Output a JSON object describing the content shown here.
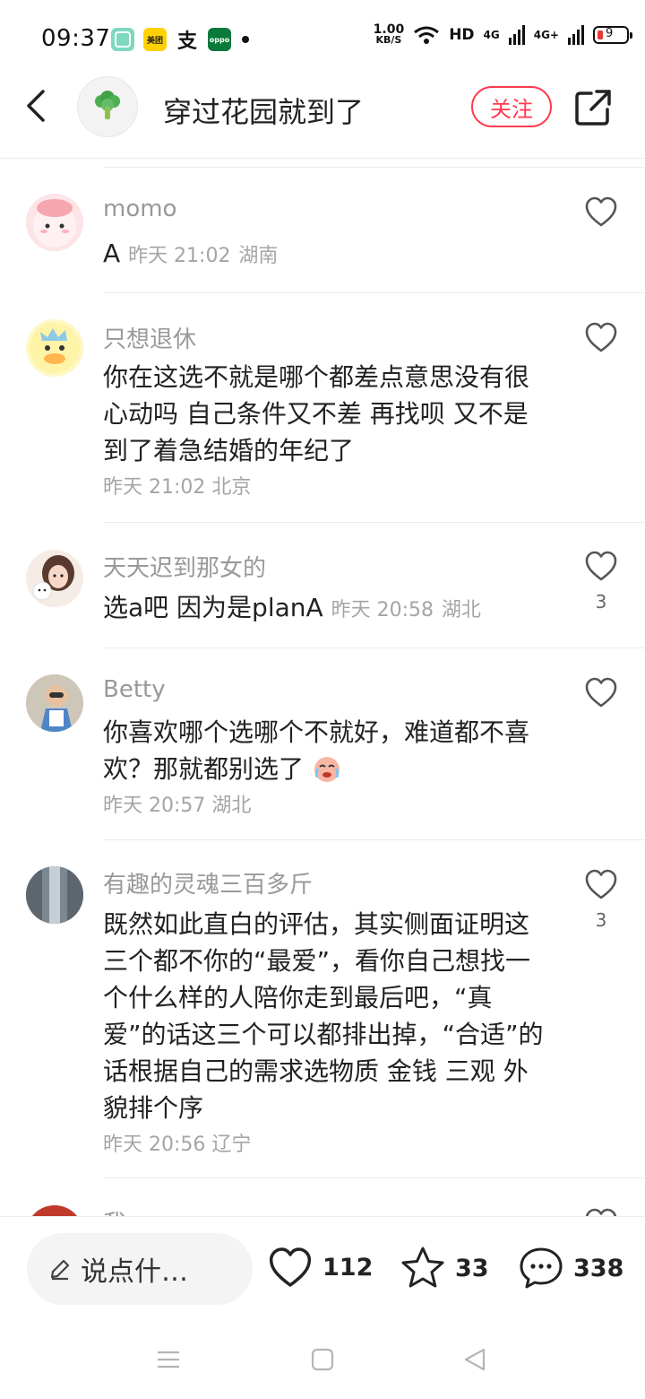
{
  "status_bar": {
    "time": "09:37",
    "net_speed_value": "1.00",
    "net_speed_unit": "KB/S",
    "hd_label": "HD",
    "signal1_label": "4G",
    "signal2_label": "4G+",
    "battery_level": "9",
    "app_icons": [
      "green-app-icon",
      "meituan-icon",
      "alipay-icon",
      "oppo-icon"
    ],
    "meituan_label": "美团",
    "alipay_label": "支",
    "oppo_label": "oppo"
  },
  "header": {
    "title": "穿过花园就到了",
    "follow_label": "关注"
  },
  "comments": [
    {
      "name": "momo",
      "text": "A",
      "time": "昨天 21:02",
      "location": "湖南",
      "likes": ""
    },
    {
      "name": "只想退休",
      "text": "你在这选不就是哪个都差点意思没有很心动吗 自己条件又不差 再找呗 又不是到了着急结婚的年纪了",
      "time": "昨天 21:02",
      "location": "北京",
      "likes": ""
    },
    {
      "name": "天天迟到那女的",
      "text": "选a吧 因为是planA",
      "time": "昨天 20:58",
      "location": "湖北",
      "likes": "3"
    },
    {
      "name": "Betty",
      "text": "你喜欢哪个选哪个不就好，难道都不喜欢？那就都别选了",
      "time": "昨天 20:57",
      "location": "湖北",
      "likes": ""
    },
    {
      "name": "有趣的灵魂三百多斤",
      "text": "既然如此直白的评估，其实侧面证明这三个都不你的“最爱”，看你自己想找一个什么样的人陪你走到最后吧，“真爱”的话这三个可以都排出掉，“合适”的话根据自己的需求选物质 金钱 三观 外貌排个序",
      "time": "昨天 20:56",
      "location": "辽宁",
      "likes": "3"
    },
    {
      "name": "我",
      "text": "",
      "time": "",
      "location": "",
      "likes": ""
    }
  ],
  "bottom_bar": {
    "input_placeholder": "说点什…",
    "like_count": "112",
    "favorite_count": "33",
    "comment_count": "338"
  },
  "colors": {
    "accent": "#ff3a4f",
    "name_gray": "#999999",
    "meta_gray": "#a5a5a5",
    "divider": "#ececec"
  }
}
